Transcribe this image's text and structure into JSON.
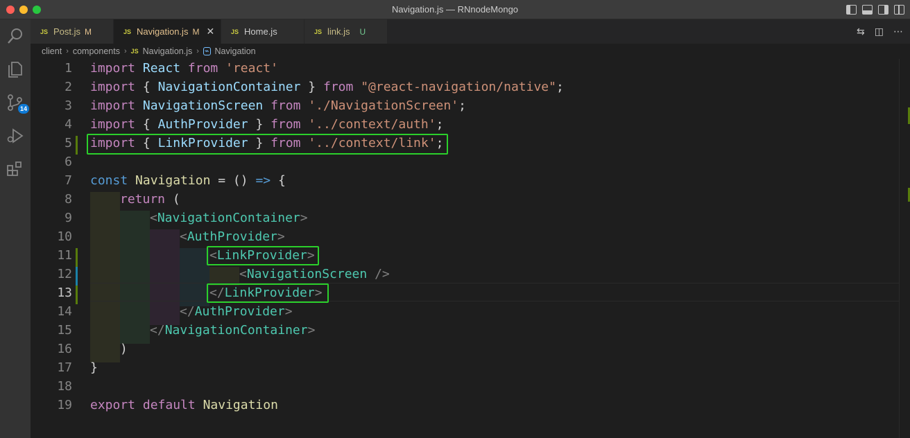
{
  "window": {
    "title": "Navigation.js — RNnodeMongo"
  },
  "tabs": [
    {
      "label": "Post.js",
      "status": "M",
      "active": false
    },
    {
      "label": "Navigation.js",
      "status": "M",
      "active": true
    },
    {
      "label": "Home.js",
      "status": "",
      "active": false
    },
    {
      "label": "link.js",
      "status": "U",
      "active": false
    }
  ],
  "js_badge": "JS",
  "breadcrumb": {
    "parts": [
      "client",
      "components",
      "Navigation.js",
      "Navigation"
    ]
  },
  "activity": {
    "scm_badge": "14"
  },
  "editor": {
    "current_line": 13,
    "line_numbers": [
      "1",
      "2",
      "3",
      "4",
      "5",
      "6",
      "7",
      "8",
      "9",
      "10",
      "11",
      "12",
      "13",
      "14",
      "15",
      "16",
      "17",
      "18",
      "19"
    ]
  },
  "code": {
    "l1": {
      "kw": "import",
      "id": "React",
      "from": "from",
      "str": "'react'"
    },
    "l2": {
      "kw": "import",
      "open": "{ ",
      "id": "NavigationContainer",
      "close": " }",
      "from": "from",
      "str": "\"@react-navigation/native\"",
      "semi": ";"
    },
    "l3": {
      "kw": "import",
      "id": "NavigationScreen",
      "from": "from",
      "str": "'./NavigationScreen'",
      "semi": ";"
    },
    "l4": {
      "kw": "import",
      "open": "{ ",
      "id": "AuthProvider",
      "close": " }",
      "from": "from",
      "str": "'../context/auth'",
      "semi": ";"
    },
    "l5": {
      "kw": "import",
      "open": "{ ",
      "id": "LinkProvider",
      "close": " }",
      "from": "from",
      "str": "'../context/link'",
      "semi": ";"
    },
    "l7": {
      "const": "const",
      "name": "Navigation",
      "eq": " = () ",
      "arrow": "=>",
      "brace": " {"
    },
    "l8": {
      "ret": "return",
      "paren": " ("
    },
    "l9": {
      "lt": "<",
      "tag": "NavigationContainer",
      "gt": ">"
    },
    "l10": {
      "lt": "<",
      "tag": "AuthProvider",
      "gt": ">"
    },
    "l11": {
      "lt": "<",
      "tag": "LinkProvider",
      "gt": ">"
    },
    "l12": {
      "lt": "<",
      "tag": "NavigationScreen",
      "gt": " />"
    },
    "l13": {
      "lt": "</",
      "tag": "LinkProvider",
      "gt": ">"
    },
    "l14": {
      "lt": "</",
      "tag": "AuthProvider",
      "gt": ">"
    },
    "l15": {
      "lt": "</",
      "tag": "NavigationContainer",
      "gt": ">"
    },
    "l16": {
      "paren": ")"
    },
    "l17": {
      "brace": "}"
    },
    "l19": {
      "kw": "export",
      "kw2": "default",
      "name": "Navigation"
    }
  },
  "colors": {
    "highlight_box": "#2bd02b",
    "keyword": "#c586c0",
    "string": "#ce9178",
    "identifier": "#9cdcfe",
    "tag": "#4ec9b0"
  }
}
